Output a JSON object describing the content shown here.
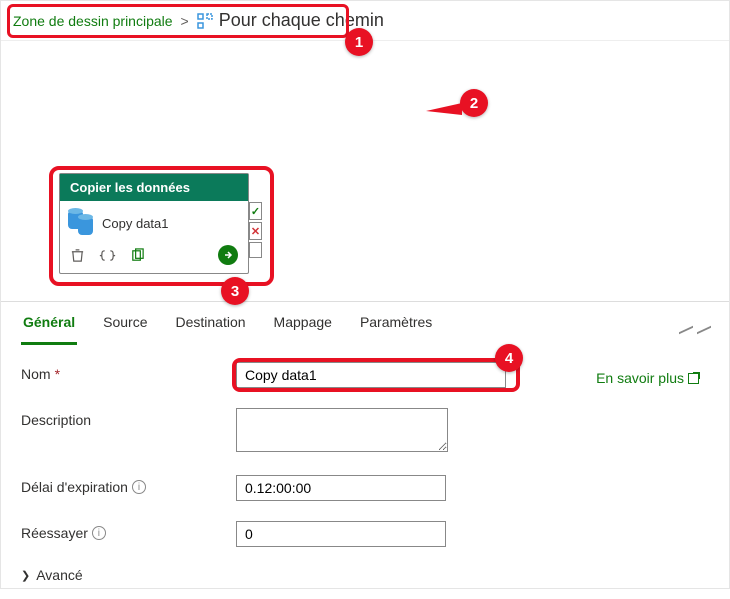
{
  "breadcrumb": {
    "root": "Zone de dessin principale",
    "current": "Pour chaque chemin"
  },
  "callouts": {
    "n1": "1",
    "n2": "2",
    "n3": "3",
    "n4": "4"
  },
  "activity": {
    "header": "Copier les données",
    "name": "Copy data1"
  },
  "tabs": {
    "general": "Général",
    "source": "Source",
    "destination": "Destination",
    "mapping": "Mappage",
    "settings": "Paramètres"
  },
  "form": {
    "name_label": "Nom",
    "name_value": "Copy data1",
    "description_label": "Description",
    "description_value": "",
    "timeout_label": "Délai d'expiration",
    "timeout_value": "0.12:00:00",
    "retry_label": "Réessayer",
    "retry_value": "0",
    "advanced_label": "Avancé",
    "learn_more": "En savoir plus"
  }
}
